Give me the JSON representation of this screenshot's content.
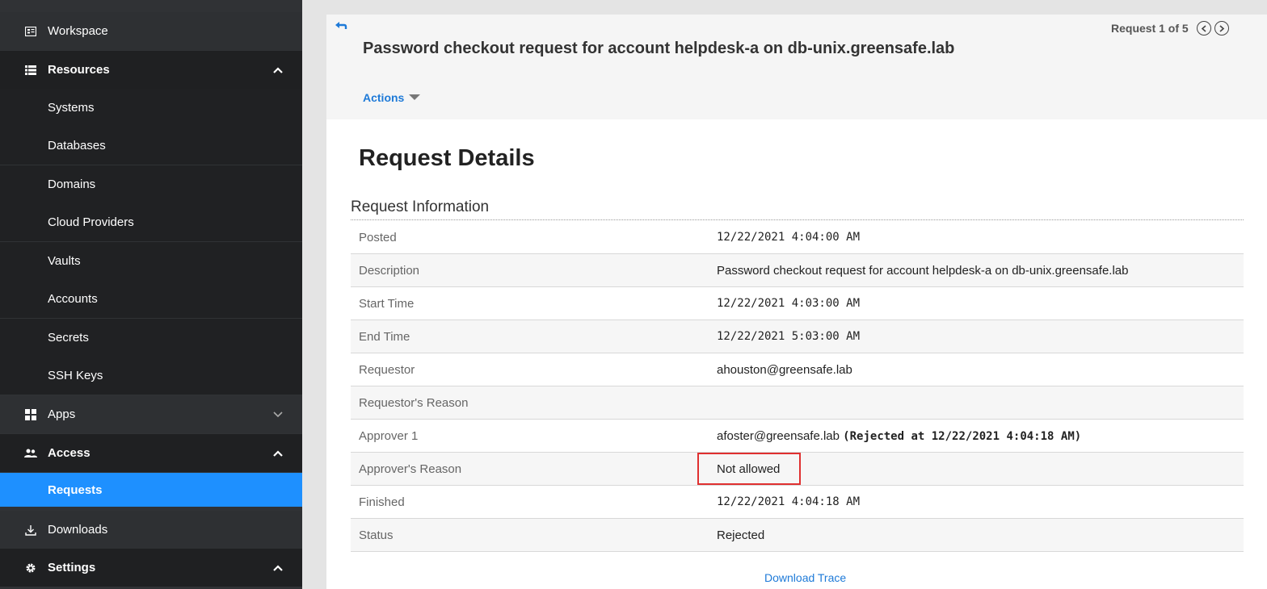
{
  "sidebar": {
    "items": [
      {
        "label": "Workspace",
        "icon": "workspace-icon"
      },
      {
        "label": "Resources",
        "icon": "list-icon",
        "chevron": "up"
      },
      {
        "label": "Systems"
      },
      {
        "label": "Databases"
      },
      {
        "label": "Domains"
      },
      {
        "label": "Cloud Providers"
      },
      {
        "label": "Vaults"
      },
      {
        "label": "Accounts"
      },
      {
        "label": "Secrets"
      },
      {
        "label": "SSH Keys"
      },
      {
        "label": "Apps",
        "icon": "apps-grid-icon",
        "chevron": "down"
      },
      {
        "label": "Access",
        "icon": "users-icon",
        "chevron": "up"
      },
      {
        "label": "Requests",
        "active": true
      },
      {
        "label": "Downloads",
        "icon": "download-icon"
      },
      {
        "label": "Settings",
        "icon": "gear-icon",
        "chevron": "up"
      }
    ]
  },
  "header": {
    "title": "Password checkout request for account helpdesk-a on db-unix.greensafe.lab",
    "pager_text": "Request 1 of 5",
    "actions_label": "Actions"
  },
  "details": {
    "heading": "Request Details",
    "section_title": "Request Information",
    "rows": [
      {
        "key": "Posted",
        "value": "12/22/2021 4:04:00 AM"
      },
      {
        "key": "Description",
        "value": "Password checkout request for account helpdesk-a on db-unix.greensafe.lab"
      },
      {
        "key": "Start Time",
        "value": "12/22/2021 4:03:00 AM"
      },
      {
        "key": "End Time",
        "value": "12/22/2021 5:03:00 AM"
      },
      {
        "key": "Requestor",
        "value": "ahouston@greensafe.lab"
      },
      {
        "key": "Requestor's Reason",
        "value": ""
      },
      {
        "key": "Approver 1",
        "value": "afoster@greensafe.lab",
        "value_extra": "(Rejected at 12/22/2021 4:04:18 AM)"
      },
      {
        "key": "Approver's Reason",
        "value": "Not allowed"
      },
      {
        "key": "Finished",
        "value": "12/22/2021 4:04:18 AM"
      },
      {
        "key": "Status",
        "value": "Rejected"
      }
    ],
    "download_label": "Download Trace"
  },
  "colors": {
    "sidebar_bg": "#303235",
    "active_bg": "#1e90ff",
    "link": "#1e7ad8",
    "highlight_border": "#e03030"
  }
}
